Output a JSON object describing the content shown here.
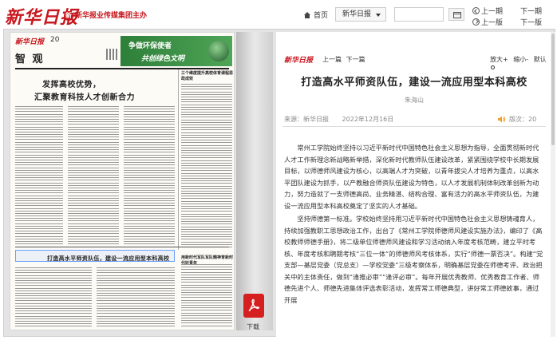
{
  "header": {
    "site_logo": "新华日报",
    "group_logo": "新华报业传媒集团主办",
    "home_label": "首页",
    "paper_select": "新华日报",
    "date_value": "",
    "prev_period": "上一期",
    "next_period": "下一期",
    "prev_page": "上一版",
    "next_page": "下一版"
  },
  "newspaper": {
    "masthead": "新华日报",
    "page_number": "20",
    "section": "智 观",
    "ad_line1": "争做环保使者",
    "ad_line2": "共创绿色文明",
    "headline1": "发挥高校优势，",
    "headline2": "汇聚教育科技人才创新合力",
    "side_headline": "三个维度提升高校体育课程思政成效",
    "bottom_headline": "打造高水平师资队伍，建设一流应用型本科高校",
    "bottom_side_headline": "用新时代军队军队精神育新时代好青年",
    "download_label": "下载"
  },
  "article": {
    "logo": "新华日报",
    "prev": "上一篇",
    "next": "下一篇",
    "zoom_in": "放大+",
    "zoom_out": "缩小-",
    "reset": "默认",
    "title": "打造高水平师资队伍，建设一流应用型本科高校",
    "author": "朱海山",
    "source": "来源：新华日报",
    "date": "2022年12月16日",
    "version": "版次：20",
    "paragraphs": [
      "常州工学院始终坚持以习近平新时代中国特色社会主义思想为指导，全面贯彻新时代人才工作新理念新战略新举措，深化新时代教师队伍建设改革，紧紧围绕学校中长期发展目标，以师德师风建设为核心，以高端人才为突破，以青年拔尖人才培养为重点，以高水平团队建设为抓手，以产教融合师资队伍建设为特色，以人才发展机制体制改革创新为动力，努力造就了一支师德高尚、业务精湛、结构合理、富有活力的高水平师资队伍，为建设一流应用型本科高校奠定了坚实的人才基础。",
      "坚持师德第一标准。学校始终坚持用习近平新时代中国特色社会主义思想铸魂育人，持续加强教职工思想政治工作，出台了《常州工学院师德师风建设实施办法》，编印了《高校教师师德手册》，将二级单位师德师风建设和学习活动纳入年度考核范畴，建立平时考核、年度考核和聘期考核“三位一体”的师德师风考核体系，实行“师德一票否决”。构建“党支部—基层党委（党总支）—学校党委”三级考察体系，明确基层党委在师德考评、政治把关中的主体责任，做到“逢推必审”“逢评必审”。每年开展优秀教师、优秀教育工作者、师德先进个人、师德先进集体评选表彰活动，发挥常工师德典型，讲好常工师德故事，通过开展"
    ]
  },
  "colors": {
    "brand_red": "#c8171e",
    "ad_green": "#2e7f39"
  }
}
